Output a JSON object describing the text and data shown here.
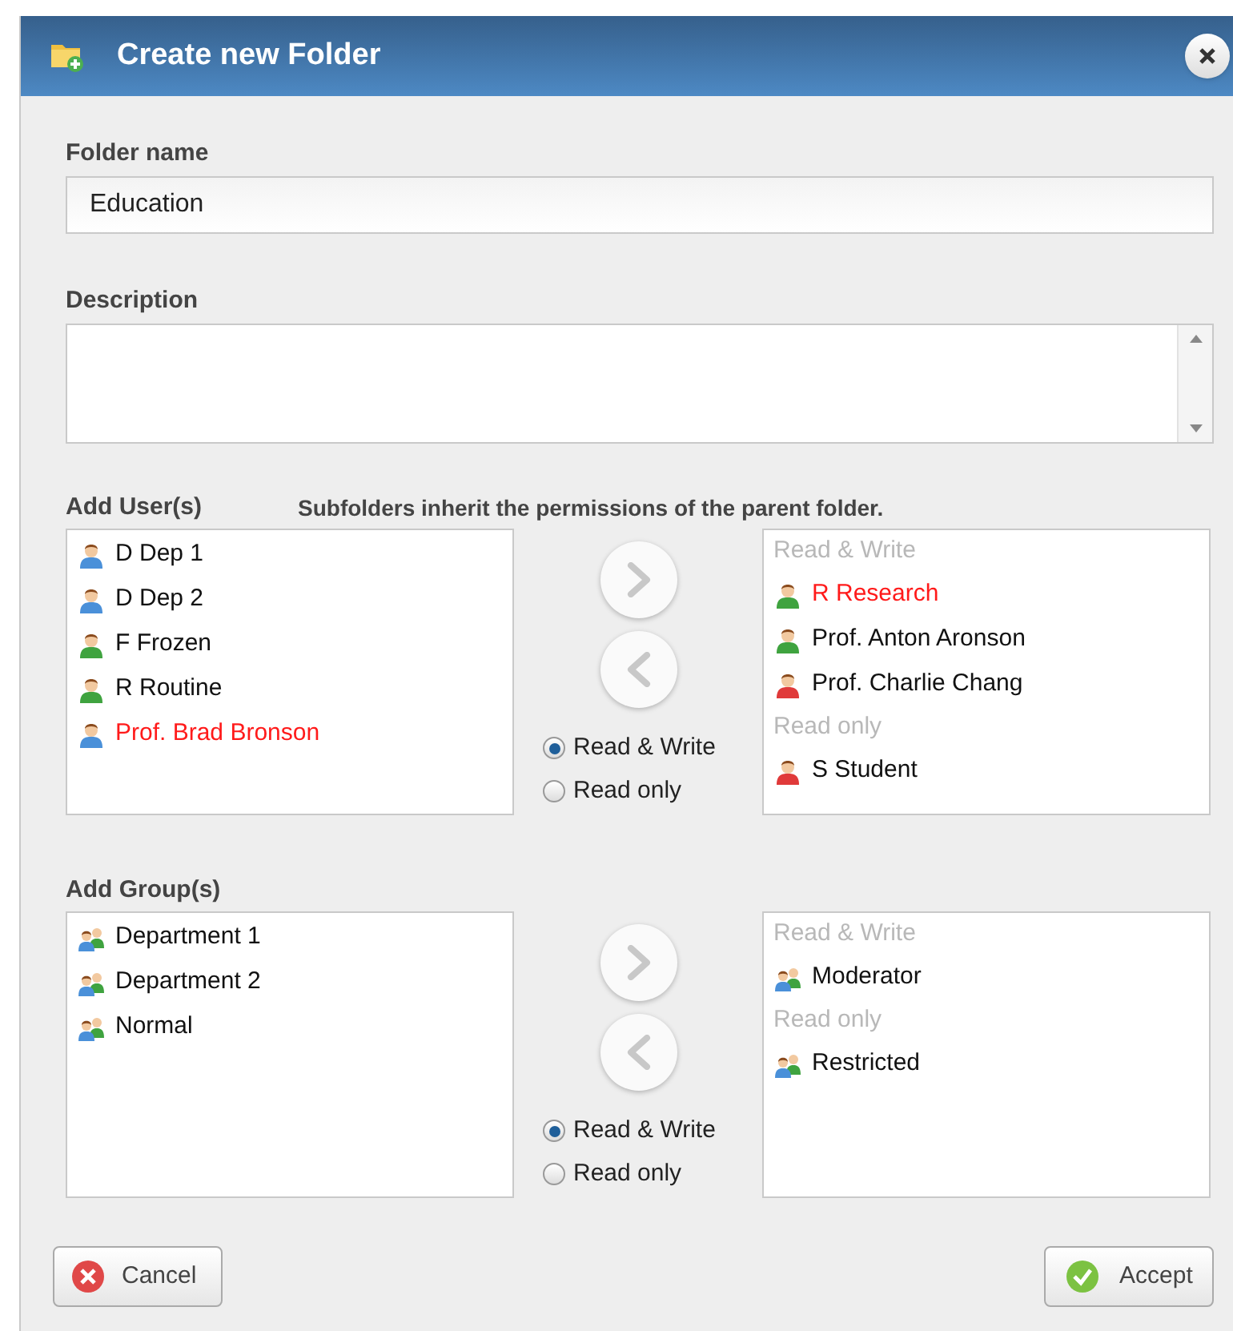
{
  "window": {
    "title": "Create new Folder"
  },
  "folder_name": {
    "label": "Folder name",
    "value": "Education"
  },
  "description": {
    "label": "Description"
  },
  "users": {
    "label": "Add User(s)",
    "note": "Subfolders inherit the permissions of the parent folder.",
    "available": [
      {
        "name": "D Dep 1",
        "color": "#4a90d9",
        "marked": false
      },
      {
        "name": "D Dep 2",
        "color": "#4a90d9",
        "marked": false
      },
      {
        "name": "F Frozen",
        "color": "#3fa33f",
        "marked": false
      },
      {
        "name": "R Routine",
        "color": "#3fa33f",
        "marked": false
      },
      {
        "name": "Prof. Brad Bronson",
        "color": "#4a90d9",
        "marked": true
      }
    ],
    "permissions": [
      {
        "label": "Read & Write",
        "selected": true
      },
      {
        "label": "Read only",
        "selected": false
      }
    ],
    "assigned": [
      {
        "kind": "heading",
        "name": "Read & Write"
      },
      {
        "kind": "user",
        "name": "R Research",
        "color": "#3fa33f",
        "marked": true
      },
      {
        "kind": "user",
        "name": "Prof. Anton Aronson",
        "color": "#3fa33f",
        "marked": false
      },
      {
        "kind": "user",
        "name": "Prof. Charlie Chang",
        "color": "#e03a3a",
        "marked": false
      },
      {
        "kind": "heading",
        "name": "Read only"
      },
      {
        "kind": "user",
        "name": "S Student",
        "color": "#e03a3a",
        "marked": false
      }
    ]
  },
  "groups": {
    "label": "Add Group(s)",
    "available": [
      {
        "name": "Department 1"
      },
      {
        "name": "Department 2"
      },
      {
        "name": "Normal"
      }
    ],
    "permissions": [
      {
        "label": "Read & Write",
        "selected": true
      },
      {
        "label": "Read only",
        "selected": false
      }
    ],
    "assigned": [
      {
        "kind": "heading",
        "name": "Read & Write"
      },
      {
        "kind": "group",
        "name": "Moderator"
      },
      {
        "kind": "heading",
        "name": "Read only"
      },
      {
        "kind": "group",
        "name": "Restricted"
      }
    ]
  },
  "buttons": {
    "cancel": "Cancel",
    "accept": "Accept"
  }
}
